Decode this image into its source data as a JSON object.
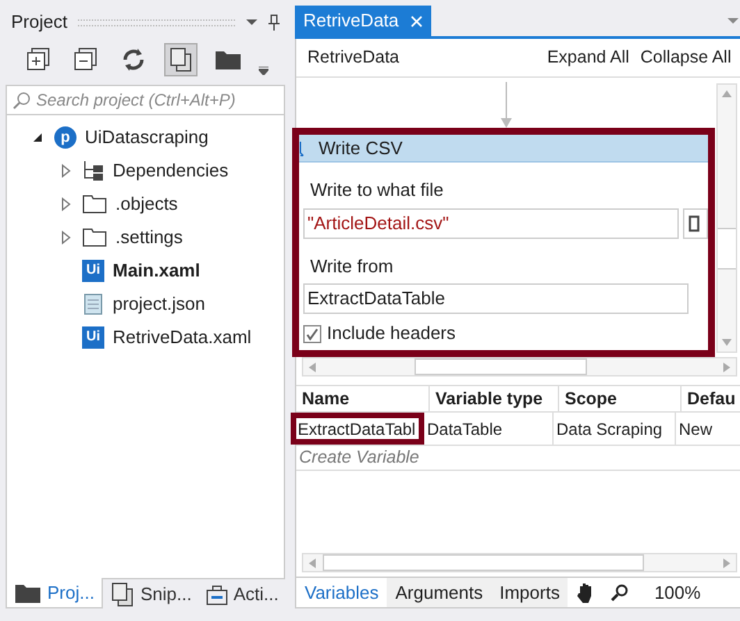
{
  "project_panel": {
    "title": "Project",
    "toolbar": [
      {
        "kind": "expand",
        "selected": false
      },
      {
        "kind": "collapse",
        "selected": false
      },
      {
        "kind": "refresh",
        "selected": false
      },
      {
        "kind": "copies",
        "selected": true
      },
      {
        "kind": "folder",
        "selected": false
      }
    ],
    "search": {
      "placeholder": "Search project (Ctrl+Alt+P)"
    },
    "tree": [
      {
        "label": "UiDatascraping",
        "kind": "project",
        "badge": "p",
        "expanded": true,
        "children": [
          {
            "label": "Dependencies",
            "kind": "dependencies",
            "expanded": false
          },
          {
            "label": ".objects",
            "kind": "folder",
            "expanded": false
          },
          {
            "label": ".settings",
            "kind": "folder",
            "expanded": false
          },
          {
            "label": "Main.xaml",
            "kind": "workflow",
            "badge": "Ui",
            "main": true
          },
          {
            "label": "project.json",
            "kind": "json",
            "main": false
          },
          {
            "label": "RetriveData.xaml",
            "kind": "workflow",
            "badge": "Ui",
            "main": false
          }
        ]
      }
    ],
    "bottom_tabs": [
      {
        "label": "Proj...",
        "kind": "folder",
        "selected": true
      },
      {
        "label": "Snip...",
        "kind": "copies",
        "selected": false
      },
      {
        "label": "Acti...",
        "kind": "toolbox",
        "selected": false
      }
    ]
  },
  "designer": {
    "tab": {
      "label": "RetriveData",
      "selected": true
    },
    "breadcrumb": "RetriveData",
    "actions": [
      "Expand All",
      "Collapse All"
    ],
    "activity": {
      "title": "Write CSV",
      "highlighted": true,
      "fields": [
        {
          "label": "Write to what file",
          "value": "\"ArticleDetail.csv\"",
          "kind": "string"
        },
        {
          "label": "Write from",
          "value": "ExtractDataTable",
          "kind": "variable"
        }
      ],
      "include_headers": {
        "label": "Include headers",
        "checked": true
      }
    }
  },
  "variables": {
    "columns": [
      "Name",
      "Variable type",
      "Scope",
      "Defau"
    ],
    "rows": [
      {
        "cells": [
          "ExtractDataTabl",
          "DataTable",
          "Data Scraping",
          "New"
        ],
        "highlighted": true
      }
    ],
    "placeholder": "Create Variable"
  },
  "bottom_bar": {
    "tabs": [
      {
        "label": "Variables",
        "selected": true
      },
      {
        "label": "Arguments",
        "selected": false
      },
      {
        "label": "Imports",
        "selected": false
      }
    ],
    "zoom": "100%"
  }
}
